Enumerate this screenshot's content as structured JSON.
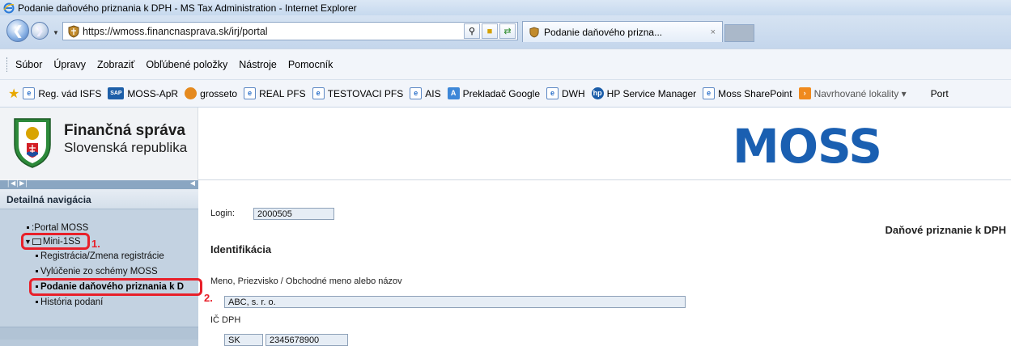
{
  "window": {
    "title": "Podanie daňového priznania k DPH - MS Tax Administration - Internet Explorer"
  },
  "address_bar": {
    "url": "https://wmoss.financnasprava.sk/irj/portal",
    "tab_title": "Podanie daňového prizna...",
    "tab_close": "×"
  },
  "menu": {
    "items": [
      "Súbor",
      "Úpravy",
      "Zobraziť",
      "Obľúbené položky",
      "Nástroje",
      "Pomocník"
    ]
  },
  "favorites": {
    "items": [
      {
        "label": "Reg. vád ISFS",
        "icon": "doc-icon"
      },
      {
        "label": "MOSS-ApR",
        "icon": "sap-icon"
      },
      {
        "label": "grosseto",
        "icon": "grosseto-icon"
      },
      {
        "label": "REAL PFS",
        "icon": "doc-icon"
      },
      {
        "label": "TESTOVACI PFS",
        "icon": "doc-icon"
      },
      {
        "label": "AIS",
        "icon": "doc-icon"
      },
      {
        "label": "Prekladač Google",
        "icon": "google-icon"
      },
      {
        "label": "DWH",
        "icon": "doc-icon"
      },
      {
        "label": "HP Service Manager",
        "icon": "hp-icon"
      },
      {
        "label": "Moss SharePoint",
        "icon": "doc-icon"
      },
      {
        "label": "Navrhované lokality ▾",
        "icon": "suggested-icon"
      },
      {
        "label": "Port",
        "icon": ""
      }
    ]
  },
  "header": {
    "org_name": "Finančná správa",
    "org_sub": "Slovenská republika",
    "logo_text": "MOSS"
  },
  "nav": {
    "title": "Detailná navigácia",
    "items": {
      "portal": ":Portal MOSS",
      "mini": "Mini-1SS",
      "registracia": "Registrácia/Zmena registrácie",
      "vylucenie": "Vylúčenie zo schémy MOSS",
      "podanie": "Podanie daňového priznania k D",
      "historia": "História podaní"
    },
    "annotations": {
      "one": "1.",
      "two": "2."
    }
  },
  "main": {
    "login_label": "Login:",
    "login_value": "2000505",
    "doc_title": "Daňové priznanie k DPH",
    "section_title": "Identifikácia",
    "name_label": "Meno, Priezvisko / Obchodné meno alebo názov",
    "name_value": "ABC, s. r. o.",
    "vat_label": "IČ DPH",
    "vat_prefix": "SK",
    "vat_value": "2345678900"
  },
  "colors": {
    "accent": "#1a5fb1",
    "annotation_red": "#e8202a",
    "nav_bg": "#c3d2e1"
  }
}
